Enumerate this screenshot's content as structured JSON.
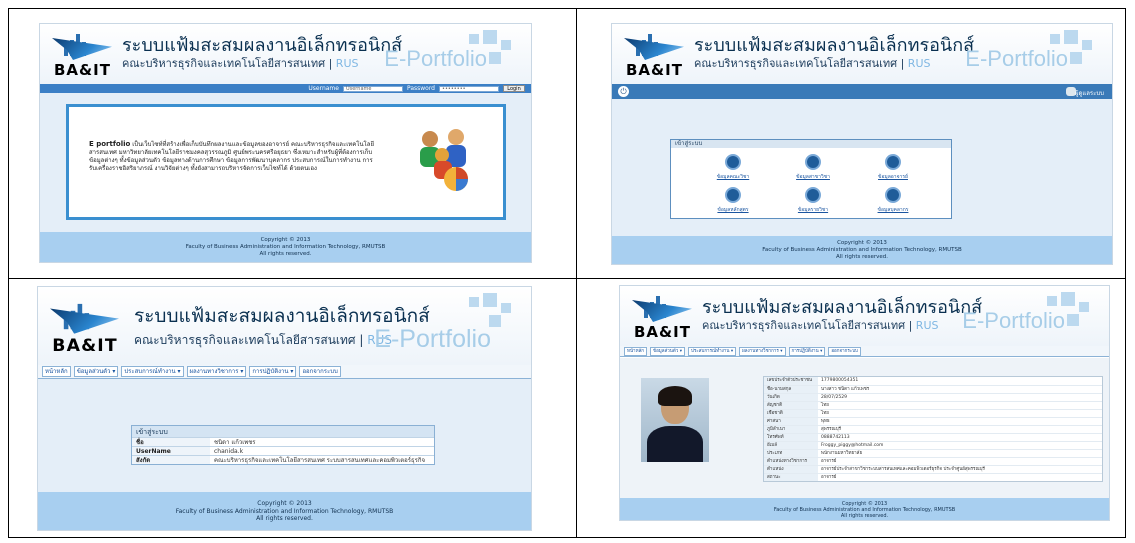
{
  "header": {
    "logo_text": "BA&IT",
    "title_th": "ระบบแฟ้มสะสมผลงานอิเล็กทรอนิกส์",
    "subtitle_th": "คณะบริหารธุรกิจและเทคโนโลยีสารสนเทศ",
    "subtitle_sep": " | ",
    "subtitle_short": "RUS",
    "eportfolio": "E-Portfolio"
  },
  "footer": {
    "line1": "Copyright © 2013",
    "line2": "Faculty of Business Administration and Information Technology, RMUTSB",
    "line3": "All rights reserved."
  },
  "screen1": {
    "username_label": "Username",
    "username_placeholder": "Username",
    "password_label": "Password",
    "password_value": "••••••••",
    "login_button": "Login",
    "intro_bold": "E portfolio",
    "intro_text": " เป็นเว็บไซท์ที่สร้างเพื่อเก็บบันทึกผลงานและข้อมูลของอาจารย์ คณะบริหารธุรกิจและเทคโนโลยีสารสนเทศ มหาวิทยาลัยเทคโนโลยีราชมงคลสุวรรณภูมิ ศูนย์พระนครศรีอยุธยา ซึ่งเหมาะสำหรับผู้ที่ต้องการเก็บข้อมูลต่างๆ ทั้งข้อมูลส่วนตัว ข้อมูลทางด้านการศึกษา ข้อมูลการพัฒนาบุคลากร ประสบการณ์ในการทำงาน การรับเครื่องราชอิสริยาภรณ์ งานวิจัยต่างๆ ทั้งยังสามารถบริหารจัดการเว็บไซท์ได้ ด้วยตนเอง"
  },
  "screen2": {
    "user_label": "ผู้ดูแลระบบ",
    "menu_title": "เข้าสู่ระบบ",
    "menu_items": [
      "ข้อมูลคณะวิชา",
      "ข้อมูลสาขาวิชา",
      "ข้อมูลอาจารย์",
      "ข้อมูลหลักสูตร",
      "ข้อมูลรายวิชา",
      "ข้อมูลบุคลากร"
    ]
  },
  "tabs": [
    "หน้าหลัก",
    "ข้อมูลส่วนตัว ▾",
    "ประสบการณ์ทำงาน ▾",
    "ผลงานทางวิชาการ ▾",
    "การปฏิบัติงาน ▾",
    "ออกจากระบบ"
  ],
  "screen3": {
    "table_title": "เข้าสู่ระบบ",
    "rows": [
      {
        "label": "ชื่อ",
        "value": "ชนิดา แก้วเพชร"
      },
      {
        "label": "UserName",
        "value": "chanida.k"
      },
      {
        "label": "สังกัด",
        "value": "คณะบริหารธุรกิจและเทคโนโลยีสารสนเทศ ระบบสารสนเทศและคอมพิวเตอร์ธุรกิจ"
      }
    ]
  },
  "screen4": {
    "rows": [
      {
        "label": "เลขประจำตัวประชาชน",
        "value": "1779800054351"
      },
      {
        "label": "ชื่อ-นามสกุล",
        "value": "นางสาว ชนิดา แก้วเพชร"
      },
      {
        "label": "วันเกิด",
        "value": "28/07/2529"
      },
      {
        "label": "สัญชาติ",
        "value": "ไทย"
      },
      {
        "label": "เชื้อชาติ",
        "value": "ไทย"
      },
      {
        "label": "ศาสนา",
        "value": "พุทธ"
      },
      {
        "label": "ภูมิลำเนา",
        "value": "สุพรรณบุรี"
      },
      {
        "label": "โทรศัพท์",
        "value": "0888742113"
      },
      {
        "label": "อีเมล์",
        "value": "Froggy_piggy@hotmail.com"
      },
      {
        "label": "ประเภท",
        "value": "พนักงานมหาวิทยาลัย"
      },
      {
        "label": "ตำแหน่งทางวิชาการ",
        "value": "อาจารย์"
      },
      {
        "label": "ตำแหน่ง",
        "value": "อาจารย์ประจำสาขาวิชาระบบสารสนเทศและคอมพิวเตอร์ธุรกิจ ประจำศูนย์สุพรรณบุรี"
      },
      {
        "label": "สถานะ",
        "value": "อาจารย์"
      }
    ]
  }
}
